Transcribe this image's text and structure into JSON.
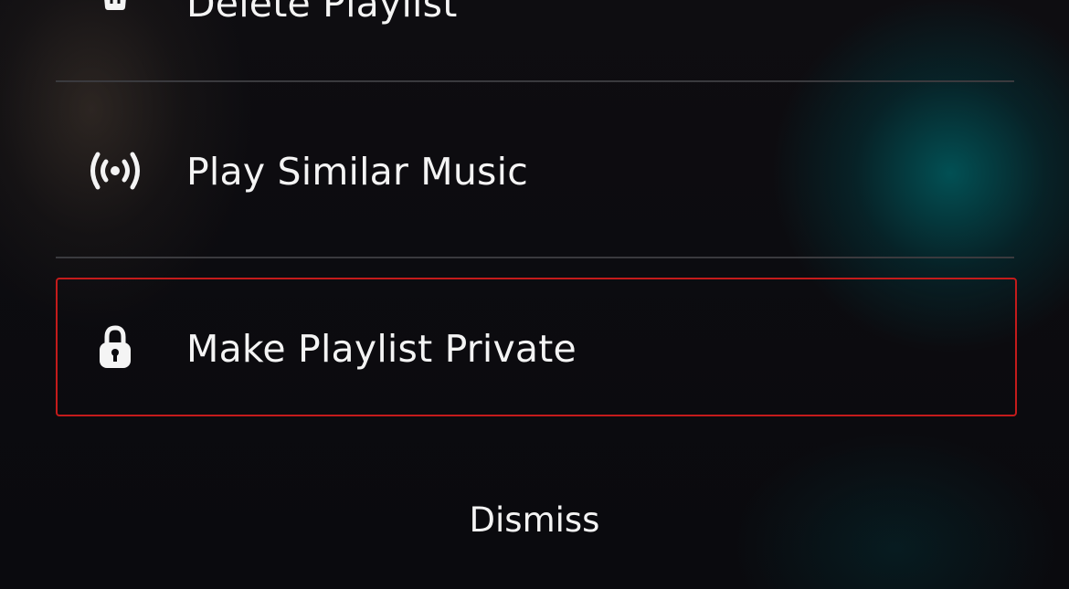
{
  "menu": {
    "items": [
      {
        "label": "Delete Playlist",
        "icon": "trash-icon"
      },
      {
        "label": "Play Similar Music",
        "icon": "broadcast-icon"
      },
      {
        "label": "Make Playlist Private",
        "icon": "lock-icon",
        "focused": true
      }
    ],
    "dismiss_label": "Dismiss"
  },
  "colors": {
    "focus_border": "#c41b1b",
    "text": "#f4f4f4",
    "background": "#0b0b0f",
    "accent_glow": "#005c60"
  }
}
